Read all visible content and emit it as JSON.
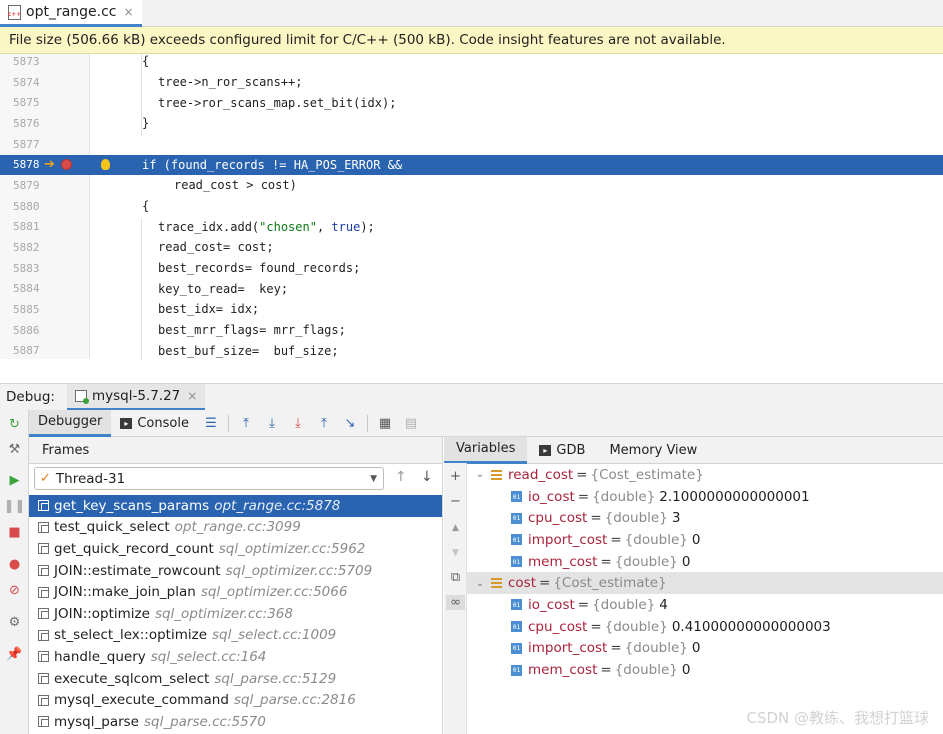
{
  "editor_tab": {
    "file_name": "opt_range.cc",
    "close": "×"
  },
  "banner": {
    "message": "File size (506.66 kB) exceeds configured limit for C/C++ (500 kB). Code insight features are not available."
  },
  "code": {
    "lines": [
      {
        "num": "5873",
        "text": "{"
      },
      {
        "num": "5874",
        "text": "tree->n_ror_scans++;"
      },
      {
        "num": "5875",
        "text": "tree->ror_scans_map.set_bit(idx);"
      },
      {
        "num": "5876",
        "text": "}"
      },
      {
        "num": "5877",
        "text": ""
      },
      {
        "num": "5878",
        "text": "if (found_records != HA_POS_ERROR &&"
      },
      {
        "num": "5879",
        "text": "read_cost > cost)"
      },
      {
        "num": "5880",
        "text": "{"
      },
      {
        "num": "5881",
        "text_before": "trace_idx.add(",
        "string": "\"chosen\"",
        "text_mid": ", ",
        "keyword": "true",
        "text_after": ");"
      },
      {
        "num": "5882",
        "text": "read_cost= cost;"
      },
      {
        "num": "5883",
        "text": "best_records= found_records;"
      },
      {
        "num": "5884",
        "text": "key_to_read=  key;"
      },
      {
        "num": "5885",
        "text": "best_idx= idx;"
      },
      {
        "num": "5886",
        "text": "best_mrr_flags= mrr_flags;"
      },
      {
        "num": "5887",
        "text": "best_buf_size=  buf_size;"
      }
    ],
    "current_line": "5878"
  },
  "debug": {
    "title": "Debug:",
    "session": "mysql-5.7.27",
    "session_close": "×",
    "tabs": {
      "debugger": "Debugger",
      "console": "Console"
    },
    "frames_header": "Frames",
    "thread": "Thread-31",
    "frames": [
      {
        "func": "get_key_scans_params",
        "loc": "opt_range.cc:5878",
        "selected": true
      },
      {
        "func": "test_quick_select",
        "loc": "opt_range.cc:3099"
      },
      {
        "func": "get_quick_record_count",
        "loc": "sql_optimizer.cc:5962"
      },
      {
        "func": "JOIN::estimate_rowcount",
        "loc": "sql_optimizer.cc:5709"
      },
      {
        "func": "JOIN::make_join_plan",
        "loc": "sql_optimizer.cc:5066"
      },
      {
        "func": "JOIN::optimize",
        "loc": "sql_optimizer.cc:368"
      },
      {
        "func": "st_select_lex::optimize",
        "loc": "sql_select.cc:1009"
      },
      {
        "func": "handle_query",
        "loc": "sql_select.cc:164"
      },
      {
        "func": "execute_sqlcom_select",
        "loc": "sql_parse.cc:5129"
      },
      {
        "func": "mysql_execute_command",
        "loc": "sql_parse.cc:2816"
      },
      {
        "func": "mysql_parse",
        "loc": "sql_parse.cc:5570"
      }
    ],
    "var_tabs": {
      "variables": "Variables",
      "gdb": "GDB",
      "memory": "Memory View"
    },
    "variables": [
      {
        "level": 0,
        "name": "read_cost",
        "type": "{Cost_estimate}",
        "value": "",
        "kind": "object"
      },
      {
        "level": 1,
        "name": "io_cost",
        "type": "{double}",
        "value": "2.1000000000000001",
        "kind": "prim"
      },
      {
        "level": 1,
        "name": "cpu_cost",
        "type": "{double}",
        "value": "3",
        "kind": "prim"
      },
      {
        "level": 1,
        "name": "import_cost",
        "type": "{double}",
        "value": "0",
        "kind": "prim"
      },
      {
        "level": 1,
        "name": "mem_cost",
        "type": "{double}",
        "value": "0",
        "kind": "prim"
      },
      {
        "level": 0,
        "name": "cost",
        "type": "{Cost_estimate}",
        "value": "",
        "kind": "object",
        "highlight": true
      },
      {
        "level": 1,
        "name": "io_cost",
        "type": "{double}",
        "value": "4",
        "kind": "prim"
      },
      {
        "level": 1,
        "name": "cpu_cost",
        "type": "{double}",
        "value": "0.41000000000000003",
        "kind": "prim"
      },
      {
        "level": 1,
        "name": "import_cost",
        "type": "{double}",
        "value": "0",
        "kind": "prim"
      },
      {
        "level": 1,
        "name": "mem_cost",
        "type": "{double}",
        "value": "0",
        "kind": "prim"
      }
    ]
  },
  "watermark": "CSDN @教练、我想打篮球",
  "colors": {
    "selection": "#2a64b0",
    "banner": "#fbf7c4",
    "accent": "#4083c9"
  }
}
